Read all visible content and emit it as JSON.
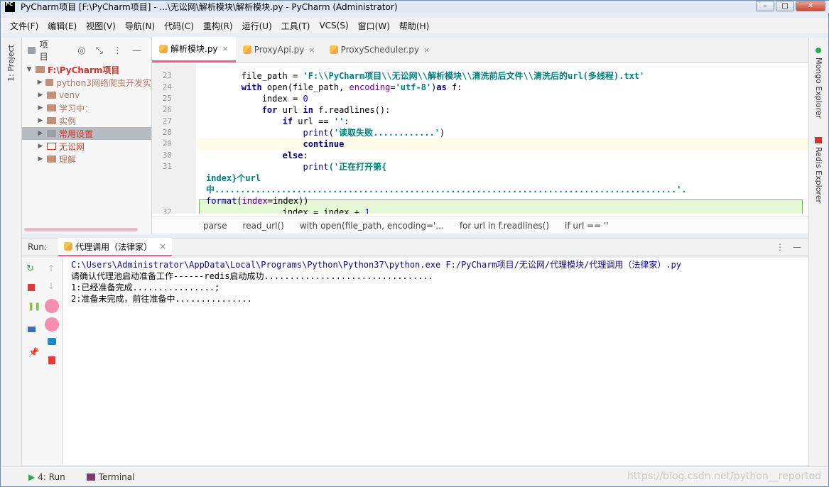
{
  "window": {
    "title": "PyCharm项目 [F:\\PyCharm项目] - ...\\无讼网\\解析模块\\解析模块.py - PyCharm (Administrator)",
    "app_icon_text": "PC"
  },
  "menu": [
    "文件(F)",
    "编辑(E)",
    "视图(V)",
    "导航(N)",
    "代码(C)",
    "重构(R)",
    "运行(U)",
    "工具(T)",
    "VCS(S)",
    "窗口(W)",
    "帮助(H)"
  ],
  "left_strip": {
    "project_label": "1: Project"
  },
  "right_strip": {
    "mongo_label": "Mongo Explorer",
    "redis_label": "Redis Explorer"
  },
  "project_panel": {
    "header": "项目",
    "tree": [
      {
        "label": "F:\\PyCharm项目",
        "expanded": true,
        "root": true
      },
      {
        "label": "python3网络爬虫开发实",
        "expanded": false
      },
      {
        "label": "venv",
        "expanded": false
      },
      {
        "label": "学习中：",
        "expanded": false
      },
      {
        "label": "实例",
        "expanded": false
      },
      {
        "label": "常用设置",
        "expanded": false,
        "selected": true
      },
      {
        "label": "无讼网",
        "expanded": false
      },
      {
        "label": "理解",
        "expanded": false
      }
    ]
  },
  "editor": {
    "tabs": [
      {
        "label": "解析模块.py",
        "active": true
      },
      {
        "label": "ProxyApi.py",
        "active": false
      },
      {
        "label": "ProxyScheduler.py",
        "active": false
      }
    ],
    "lines": {
      "l23": {
        "num": "23",
        "a": "        file_path = ",
        "b": "'F:\\\\PyCharm项目\\\\无讼网\\\\解析模块\\\\清洗前后文件\\\\清洗后的url(多线程).txt'"
      },
      "l24": {
        "num": "24",
        "a": "with",
        "b": " open(file_path, ",
        "c": "encoding",
        "d": "=",
        "e": "'utf-8'",
        "f": ")",
        "g": "as",
        "h": " f:"
      },
      "l25": {
        "num": "25",
        "a": "            index = ",
        "b": "0"
      },
      "l26": {
        "num": "26",
        "a": "for",
        "b": " url ",
        "c": "in",
        "d": " f.readlines():"
      },
      "l27": {
        "num": "27",
        "a": "if",
        "b": " url == ",
        "c": "''",
        "d": ":"
      },
      "l28": {
        "num": "28",
        "a": "print",
        "b": "(",
        "c": "'读取失败............'",
        "d": ")"
      },
      "l29": {
        "num": "29",
        "a": "continue"
      },
      "l30": {
        "num": "30",
        "a": "else",
        "b": ":"
      },
      "l31": {
        "num": "31",
        "a": "print",
        "b": "('正在打开第{"
      },
      "l31b": {
        "text": "index}个url"
      },
      "l31c": {
        "text": "中..........................................................................................'."
      },
      "l31d": {
        "a": "format",
        "b": "(",
        "c": "index",
        "d": "=index))"
      },
      "l32": {
        "num": "32",
        "a": "                index = index + ",
        "b": "1"
      }
    }
  },
  "breadcrumb": [
    "parse",
    "read_url()",
    "with open(file_path, encoding='...",
    "for url in f.readlines()",
    "if url == ''"
  ],
  "run": {
    "label": "Run:",
    "tab_label": "代理调用（法律家）",
    "console_lines": [
      "C:\\Users\\Administrator\\AppData\\Local\\Programs\\Python\\Python37\\python.exe F:/PyCharm项目/无讼网/代理模块/代理调用（法律家）.py",
      "请确认代理池启动准备工作------redis启动成功.................................",
      "1:已经准备完成................;",
      "2:准备未完成，前往准备中..............."
    ]
  },
  "statusbar": {
    "run_label": "4: Run",
    "terminal_label": "Terminal"
  },
  "watermark": "https://blog.csdn.net/python__reported",
  "colors": {
    "accent_tab": "#f0648a",
    "keyword": "#000080",
    "string": "#008080",
    "number": "#0000ff",
    "folder": "#c3907a",
    "highlight_bg": "#e6f7d5",
    "highlight_border": "#58c24a"
  }
}
